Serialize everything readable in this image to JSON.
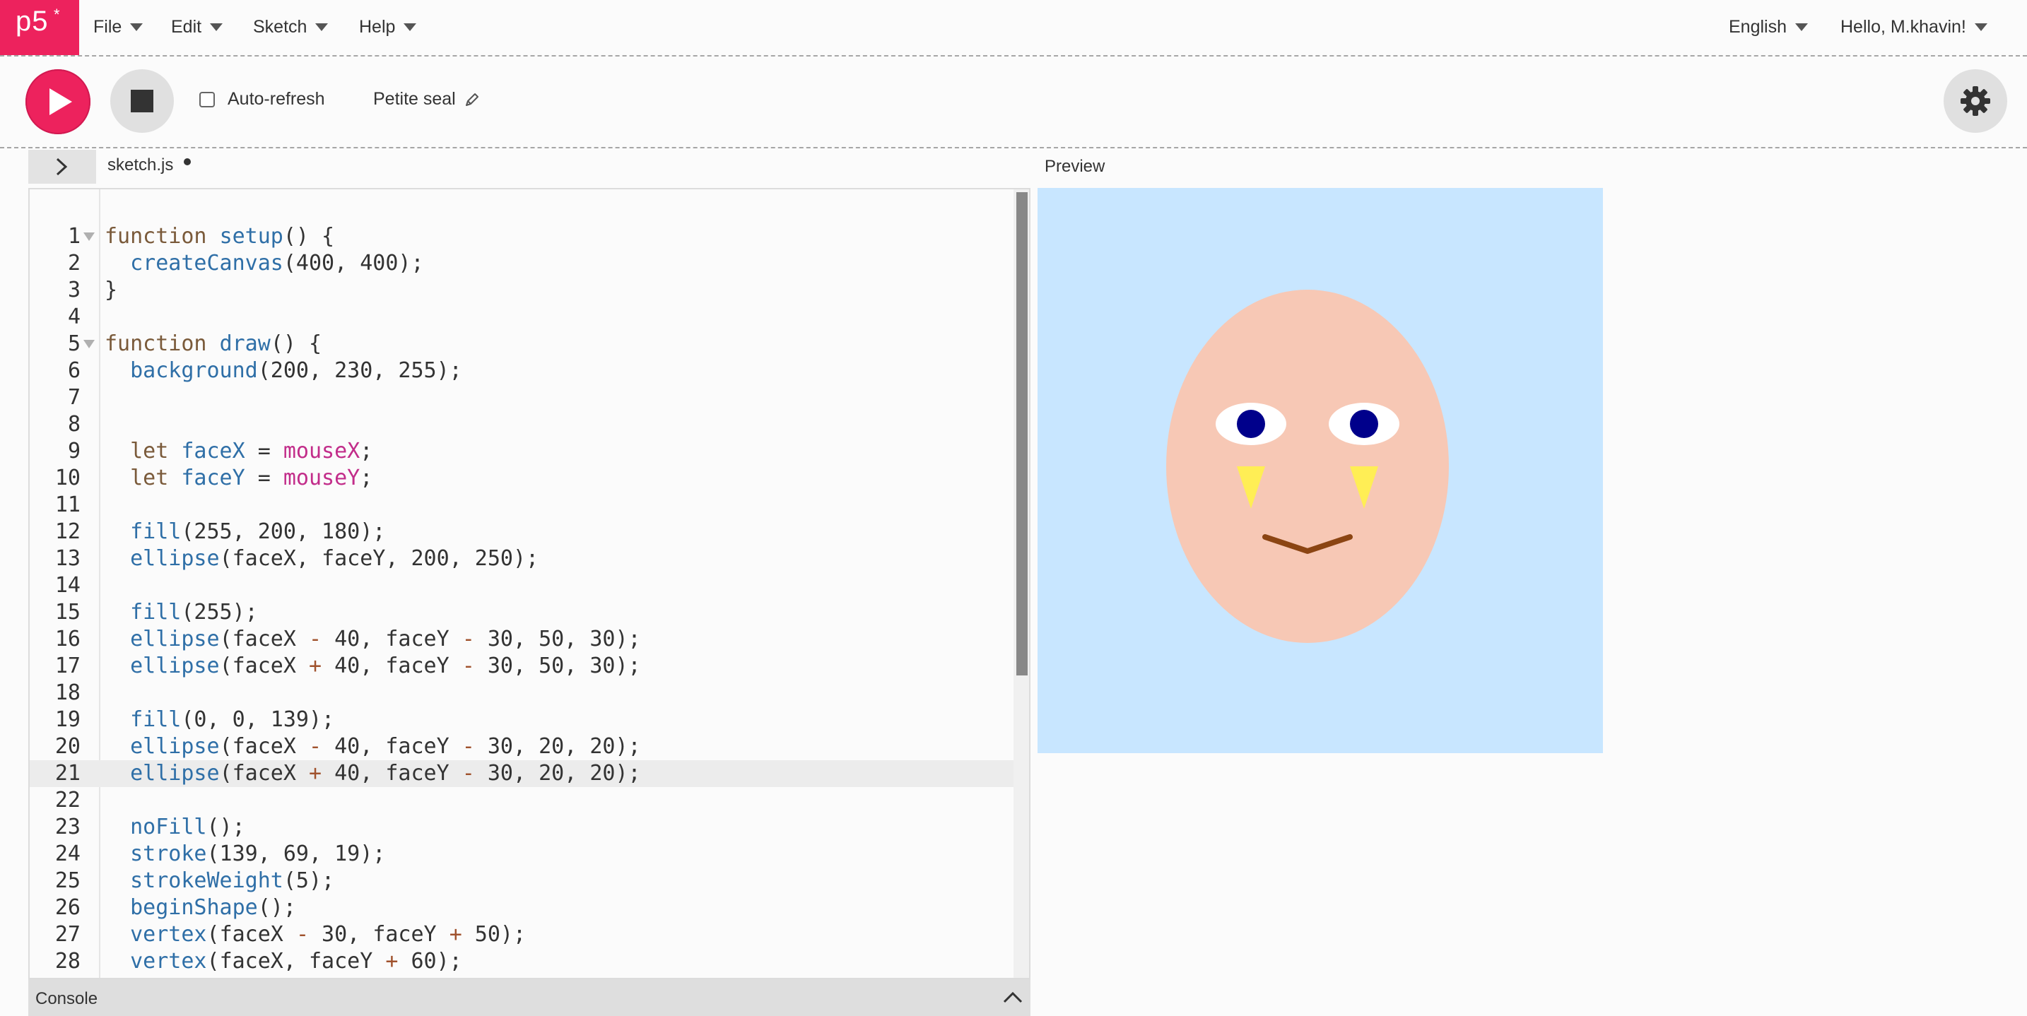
{
  "nav": {
    "logo": "p5",
    "logo_star": "*",
    "menu": [
      "File",
      "Edit",
      "Sketch",
      "Help"
    ],
    "language": "English",
    "user": "Hello, M.khavin!"
  },
  "toolbar": {
    "auto_refresh_label": "Auto-refresh",
    "auto_refresh_checked": false,
    "sketch_name": "Petite seal"
  },
  "editor": {
    "file_name": "sketch.js",
    "unsaved": true,
    "active_line": 21,
    "lines": [
      "function setup() {",
      "  createCanvas(400, 400);",
      "}",
      "",
      "function draw() {",
      "  background(200, 230, 255);",
      "",
      "",
      "  let faceX = mouseX;",
      "  let faceY = mouseY;",
      "",
      "  fill(255, 200, 180);",
      "  ellipse(faceX, faceY, 200, 250);",
      "",
      "  fill(255);",
      "  ellipse(faceX - 40, faceY - 30, 50, 30);",
      "  ellipse(faceX + 40, faceY - 30, 50, 30);",
      "",
      "  fill(0, 0, 139);",
      "  ellipse(faceX - 40, faceY - 30, 20, 20);",
      "  ellipse(faceX + 40, faceY - 30, 20, 20);",
      "",
      "  noFill();",
      "  stroke(139, 69, 19);",
      "  strokeWeight(5);",
      "  beginShape();",
      "  vertex(faceX - 30, faceY + 50);",
      "  vertex(faceX, faceY + 60);"
    ]
  },
  "preview": {
    "label": "Preview",
    "background": "#c8e6ff",
    "face_color": "#f7c8b5",
    "eye_white": "#ffffff",
    "pupil_color": "#00008b",
    "tear_color": "#ffee55",
    "mouth_color": "#8b4513"
  },
  "console": {
    "label": "Console"
  },
  "colors": {
    "accent": "#ed225d"
  }
}
